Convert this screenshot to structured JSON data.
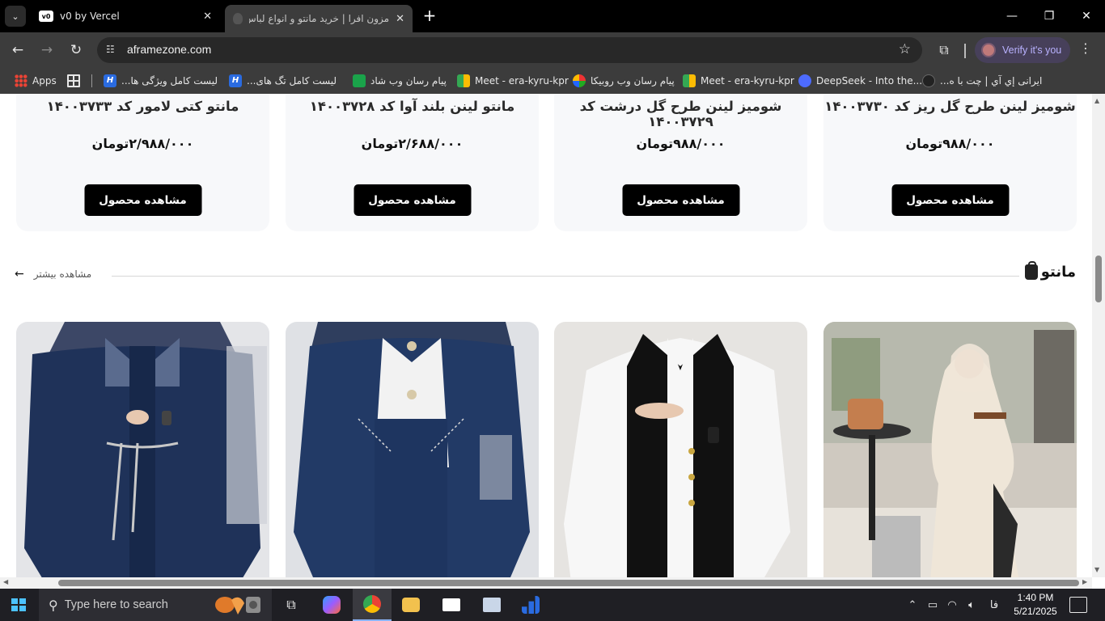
{
  "browser": {
    "tabs": [
      {
        "title": "v0 by Vercel",
        "favicon": "v0-icon",
        "active": false
      },
      {
        "title": "مزون افرا | خرید مانتو و انواع لباس",
        "favicon": "afra-icon",
        "active": true
      }
    ],
    "url": "aframezone.com",
    "profile_label": "Verify it's you",
    "bookmarks": [
      {
        "label": "Apps",
        "icon": "apps-icon"
      },
      {
        "label": "",
        "icon": "grid-icon"
      },
      {
        "label": "لیست کامل ویژگی ها...",
        "icon": "jira-icon"
      },
      {
        "label": "لیست کامل تگ های...",
        "icon": "jira-icon"
      },
      {
        "label": "پیام رسان وب شاد",
        "icon": "shad-icon"
      },
      {
        "label": "Meet - era-kyru-kpr",
        "icon": "meet-icon"
      },
      {
        "label": "پیام رسان وب روبیکا",
        "icon": "rubika-icon"
      },
      {
        "label": "Meet - era-kyru-kpr",
        "icon": "meet-icon"
      },
      {
        "label": "DeepSeek - Into the...",
        "icon": "deepseek-icon"
      },
      {
        "label": "ایرانی إي آي | چت با ه...",
        "icon": "bot-icon"
      }
    ]
  },
  "products": [
    {
      "title": "شومیز لینن طرح گل ریز کد ۱۴۰۰۳۷۳۰",
      "price": "۹۸۸/۰۰۰تومان",
      "button": "مشاهده محصول"
    },
    {
      "title": "شومیز لینن طرح گل درشت کد ۱۴۰۰۳۷۲۹",
      "price": "۹۸۸/۰۰۰تومان",
      "button": "مشاهده محصول"
    },
    {
      "title": "مانتو لینن بلند آوا کد ۱۴۰۰۳۷۲۸",
      "price": "۲/۶۸۸/۰۰۰تومان",
      "button": "مشاهده محصول"
    },
    {
      "title": "مانتو کتی لامور کد ۱۴۰۰۳۷۳۳",
      "price": "۲/۹۸۸/۰۰۰تومان",
      "button": "مشاهده محصول"
    }
  ],
  "section": {
    "title": "مانتو",
    "see_more": "مشاهده بیشتر"
  },
  "photos": [
    {
      "alt": "cream linen outfit",
      "colors": {
        "bg": "#d9d4cc",
        "garment": "#efe6d8"
      }
    },
    {
      "alt": "black vest white shirt",
      "colors": {
        "bg": "#e6e4e1",
        "garment": "#111111"
      }
    },
    {
      "alt": "navy denim jacket",
      "colors": {
        "bg": "#dfe1e5",
        "garment": "#223a66"
      }
    },
    {
      "alt": "navy belted blazer",
      "colors": {
        "bg": "#e4e5e8",
        "garment": "#1f3259"
      }
    }
  ],
  "taskbar": {
    "search_placeholder": "Type here to search",
    "time": "1:40 PM",
    "date": "5/21/2025",
    "lang": "فا"
  }
}
